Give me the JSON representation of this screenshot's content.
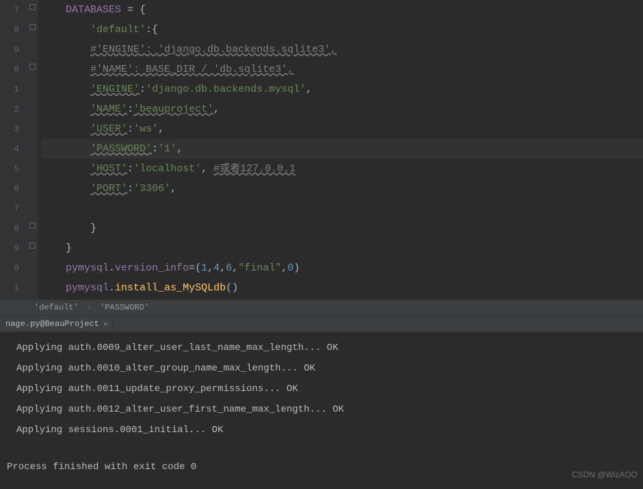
{
  "editor": {
    "lines": [
      {
        "num": "7",
        "fold": "open",
        "tokens": [
          {
            "t": "var",
            "v": "DATABASES"
          },
          {
            "t": "op",
            "v": " = {"
          }
        ]
      },
      {
        "num": "8",
        "fold": "open",
        "tokens": [
          {
            "t": "op",
            "v": "    "
          },
          {
            "t": "str",
            "v": "'default'"
          },
          {
            "t": "op",
            "v": ":{"
          }
        ]
      },
      {
        "num": "9",
        "fold": "",
        "tokens": [
          {
            "t": "op",
            "v": "    "
          },
          {
            "t": "commentul",
            "v": "#'ENGINE': 'django.db.backends.sqlite3',"
          }
        ]
      },
      {
        "num": "0",
        "fold": "half",
        "tokens": [
          {
            "t": "op",
            "v": "    "
          },
          {
            "t": "commentul",
            "v": "#'NAME': BASE_DIR / 'db.sqlite3',"
          }
        ]
      },
      {
        "num": "1",
        "fold": "",
        "tokens": [
          {
            "t": "op",
            "v": "    "
          },
          {
            "t": "strkey",
            "v": "'ENGINE'"
          },
          {
            "t": "op",
            "v": ":"
          },
          {
            "t": "str",
            "v": "'django.db.backends.mysql'"
          },
          {
            "t": "op",
            "v": ","
          }
        ]
      },
      {
        "num": "2",
        "fold": "",
        "tokens": [
          {
            "t": "op",
            "v": "    "
          },
          {
            "t": "strkey",
            "v": "'NAME'"
          },
          {
            "t": "op",
            "v": ":"
          },
          {
            "t": "strkey",
            "v": "'beauproject'"
          },
          {
            "t": "op",
            "v": ","
          }
        ]
      },
      {
        "num": "3",
        "fold": "",
        "tokens": [
          {
            "t": "op",
            "v": "    "
          },
          {
            "t": "strkey",
            "v": "'USER'"
          },
          {
            "t": "op",
            "v": ":"
          },
          {
            "t": "str",
            "v": "'ws'"
          },
          {
            "t": "op",
            "v": ","
          }
        ]
      },
      {
        "num": "4",
        "fold": "",
        "hl": true,
        "tokens": [
          {
            "t": "op",
            "v": "    "
          },
          {
            "t": "strkey",
            "v": "'PASSWORD'"
          },
          {
            "t": "op",
            "v": ":"
          },
          {
            "t": "str",
            "v": "'1'"
          },
          {
            "t": "op",
            "v": ","
          }
        ]
      },
      {
        "num": "5",
        "fold": "",
        "tokens": [
          {
            "t": "op",
            "v": "    "
          },
          {
            "t": "strkey",
            "v": "'HOST'"
          },
          {
            "t": "op",
            "v": ":"
          },
          {
            "t": "str",
            "v": "'localhost'"
          },
          {
            "t": "op",
            "v": ", "
          },
          {
            "t": "commentul",
            "v": "#或者127.0.0.1"
          }
        ]
      },
      {
        "num": "6",
        "fold": "",
        "tokens": [
          {
            "t": "op",
            "v": "    "
          },
          {
            "t": "strkey",
            "v": "'PORT'"
          },
          {
            "t": "op",
            "v": ":"
          },
          {
            "t": "str",
            "v": "'3306'"
          },
          {
            "t": "op",
            "v": ","
          }
        ]
      },
      {
        "num": "7",
        "fold": "",
        "tokens": [
          {
            "t": "op",
            "v": ""
          }
        ]
      },
      {
        "num": "8",
        "fold": "close",
        "tokens": [
          {
            "t": "op",
            "v": "    }"
          }
        ]
      },
      {
        "num": "9",
        "fold": "close",
        "tokens": [
          {
            "t": "op",
            "v": "}"
          }
        ]
      },
      {
        "num": "0",
        "fold": "",
        "tokens": [
          {
            "t": "var",
            "v": "pymysql"
          },
          {
            "t": "op",
            "v": "."
          },
          {
            "t": "var",
            "v": "version_info"
          },
          {
            "t": "op",
            "v": "=("
          },
          {
            "t": "num",
            "v": "1"
          },
          {
            "t": "op",
            "v": ","
          },
          {
            "t": "num",
            "v": "4"
          },
          {
            "t": "op",
            "v": ","
          },
          {
            "t": "num",
            "v": "6"
          },
          {
            "t": "op",
            "v": ","
          },
          {
            "t": "str",
            "v": "\"final\""
          },
          {
            "t": "op",
            "v": ","
          },
          {
            "t": "num",
            "v": "0"
          },
          {
            "t": "op",
            "v": ")"
          }
        ]
      },
      {
        "num": "1",
        "fold": "",
        "tokens": [
          {
            "t": "var",
            "v": "pymysql"
          },
          {
            "t": "op",
            "v": "."
          },
          {
            "t": "fn",
            "v": "install_as_MySQLdb"
          },
          {
            "t": "op",
            "v": "()"
          }
        ]
      }
    ]
  },
  "breadcrumb": {
    "items": [
      "'default'",
      "'PASSWORD'"
    ]
  },
  "tab": {
    "label": "nage.py@BeauProject"
  },
  "console": {
    "lines": [
      "Applying auth.0009_alter_user_last_name_max_length... OK",
      "Applying auth.0010_alter_group_name_max_length... OK",
      "Applying auth.0011_update_proxy_permissions... OK",
      "Applying auth.0012_alter_user_first_name_max_length... OK",
      "Applying sessions.0001_initial... OK"
    ],
    "exit": "Process finished with exit code 0"
  },
  "watermark": "CSDN @WizAOO"
}
